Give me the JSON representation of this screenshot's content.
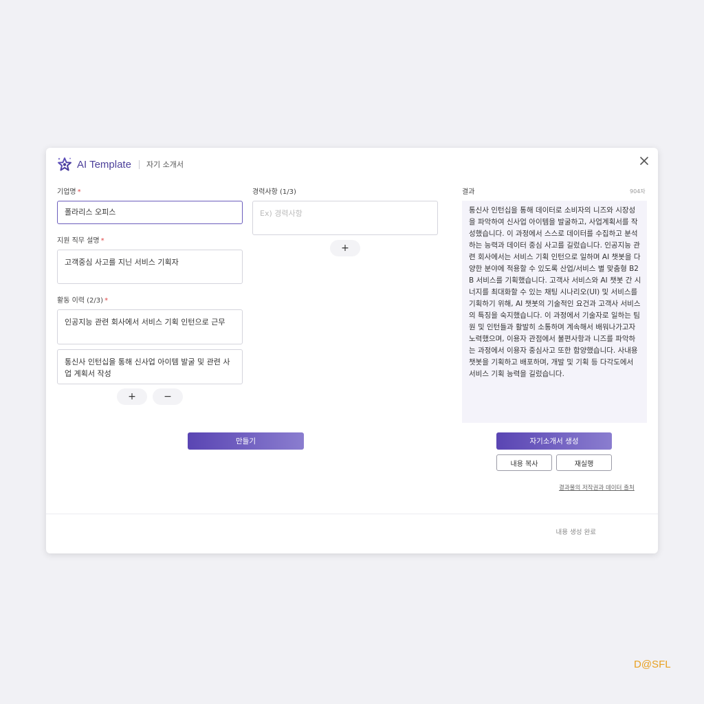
{
  "header": {
    "app_title": "AI Template",
    "subtitle": "자기 소개서"
  },
  "form": {
    "company": {
      "label": "기업명",
      "required_mark": "*",
      "value": "폴라리스 오피스"
    },
    "job_description": {
      "label": "지원 직무 설명",
      "required_mark": "*",
      "value": "고객중심 사고를 지닌 서비스 기획자"
    },
    "activities": {
      "label": "활동 이력 (2/3)",
      "required_mark": "*",
      "items": [
        "인공지능 관련 회사에서 서비스 기획 인턴으로 근무",
        "통신사 인턴십을 통해 신사업 아이템 발굴 및 관련 사업 계획서 작성"
      ],
      "add_label": "+",
      "remove_label": "−"
    },
    "career": {
      "label": "경력사항 (1/3)",
      "placeholder": "Ex) 경력사항",
      "add_label": "+"
    },
    "create_button": "만들기"
  },
  "result": {
    "label": "결과",
    "char_count": "904자",
    "text": "통신사 인턴십을 통해 데이터로 소비자의 니즈와 시장성을 파악하여 신사업 아이템을 발굴하고, 사업계획서를 작성했습니다. 이 과정에서 스스로 데이터를 수집하고 분석하는 능력과 데이터 중심 사고를 길렀습니다. 인공지능 관련 회사에서는 서비스 기획 인턴으로 일하며 AI 챗봇을 다양한 분야에 적용할 수 있도록 산업/서비스 별 맞춤형 B2B 서비스를 기획했습니다. 고객사 서비스와 AI 챗봇 간 시너지를 최대화할 수 있는 채팅 시나리오(UI) 및 서비스를 기획하기 위해, AI 챗봇의 기술적인 요건과 고객사 서비스의 특징을 숙지했습니다. 이 과정에서 기술자로 일하는 팀원 및 인턴들과 활발히 소통하며 계속해서 배워나가고자 노력했으며, 이용자 관점에서 불편사항과 니즈를 파악하는 과정에서 이용자 중심사고 또한 함양했습니다. 사내용 챗봇을 기획하고 배포하며, 개발 및 기획 등 다각도에서 서비스 기획 능력을 길렀습니다.",
    "generate_button": "자기소개서 생성",
    "copy_button": "내용 복사",
    "rerun_button": "재실행",
    "copyright_link": "결과물의 저작권과 데이터 출처"
  },
  "footer": {
    "status": "내용 생성 완료"
  },
  "watermark": "D@SFL",
  "colors": {
    "accent": "#5a45b3",
    "accent_light": "#8a7dcf",
    "required": "#e04848",
    "result_bg": "#f4f3fa",
    "watermark": "#e8a020"
  },
  "icons": {
    "logo": "star-sparkle-icon",
    "close": "close-icon"
  }
}
